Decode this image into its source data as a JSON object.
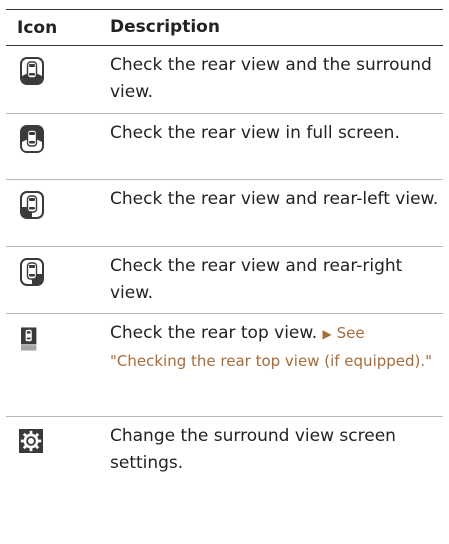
{
  "header": {
    "icon": "Icon",
    "description": "Description"
  },
  "rows": [
    {
      "icon": "rear-surround-view-icon",
      "text": "Check the rear view and the surround view."
    },
    {
      "icon": "rear-full-screen-icon",
      "text": "Check the rear view in full screen."
    },
    {
      "icon": "rear-left-view-icon",
      "text": "Check the rear view and rear-left view."
    },
    {
      "icon": "rear-right-view-icon",
      "text": "Check the rear view and rear-right view."
    },
    {
      "icon": "rear-top-view-icon",
      "text": "Check the rear top view.",
      "link_prefix": "See",
      "link_text": "\"Checking the rear top view (if equipped).\""
    },
    {
      "icon": "settings-gear-icon",
      "text": "Change the surround view screen settings."
    }
  ],
  "colors": {
    "icon_dark": "#3a3a3a",
    "link": "#a86b3a",
    "rule": "#333333"
  }
}
